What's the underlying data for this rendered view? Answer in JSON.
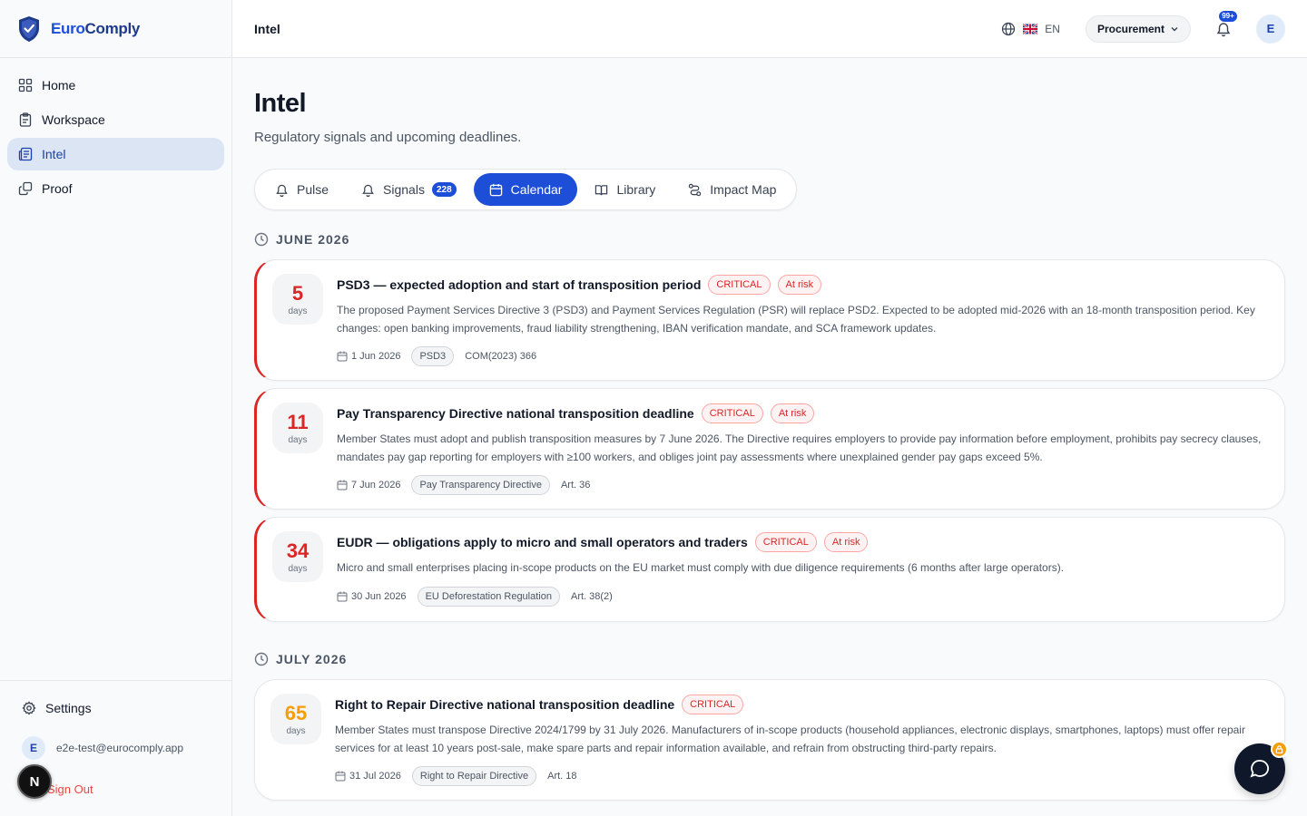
{
  "brand": {
    "name_part1": "Euro",
    "name_part2": "Comply"
  },
  "sidebar": {
    "items": [
      {
        "label": "Home",
        "icon": "grid-icon"
      },
      {
        "label": "Workspace",
        "icon": "clipboard-icon"
      },
      {
        "label": "Intel",
        "icon": "newspaper-icon",
        "active": true
      },
      {
        "label": "Proof",
        "icon": "copy-icon"
      }
    ],
    "settings_label": "Settings",
    "user_initial": "E",
    "user_email": "e2e-test@eurocomply.app",
    "signout_label": "Sign Out",
    "dev_badge": "N"
  },
  "header": {
    "title": "Intel",
    "language": "EN",
    "role": "Procurement",
    "notifications_badge": "99+",
    "avatar_initial": "E"
  },
  "page": {
    "title": "Intel",
    "subtitle": "Regulatory signals and upcoming deadlines."
  },
  "tabs": [
    {
      "label": "Pulse",
      "icon": "bell-icon"
    },
    {
      "label": "Signals",
      "icon": "bell-icon",
      "count": "228"
    },
    {
      "label": "Calendar",
      "icon": "calendar-icon",
      "active": true
    },
    {
      "label": "Library",
      "icon": "book-icon"
    },
    {
      "label": "Impact Map",
      "icon": "route-icon"
    }
  ],
  "months": [
    {
      "label": "JUNE 2026",
      "deadlines": [
        {
          "days": "5",
          "days_label": "days",
          "urgency_color": "#dc2626",
          "title": "PSD3 — expected adoption and start of transposition period",
          "severity": "CRITICAL",
          "status": "At risk",
          "description": "The proposed Payment Services Directive 3 (PSD3) and Payment Services Regulation (PSR) will replace PSD2. Expected to be adopted mid-2026 with an 18-month transposition period. Key changes: open banking improvements, fraud liability strengthening, IBAN verification mandate, and SCA framework updates.",
          "date": "1 Jun 2026",
          "tag": "PSD3",
          "reference": "COM(2023) 366"
        },
        {
          "days": "11",
          "days_label": "days",
          "urgency_color": "#dc2626",
          "title": "Pay Transparency Directive national transposition deadline",
          "severity": "CRITICAL",
          "status": "At risk",
          "description": "Member States must adopt and publish transposition measures by 7 June 2026. The Directive requires employers to provide pay information before employment, prohibits pay secrecy clauses, mandates pay gap reporting for employers with ≥100 workers, and obliges joint pay assessments where unexplained gender pay gaps exceed 5%.",
          "date": "7 Jun 2026",
          "tag": "Pay Transparency Directive",
          "reference": "Art. 36"
        },
        {
          "days": "34",
          "days_label": "days",
          "urgency_color": "#dc2626",
          "title": "EUDR — obligations apply to micro and small operators and traders",
          "severity": "CRITICAL",
          "status": "At risk",
          "description": "Micro and small enterprises placing in-scope products on the EU market must comply with due diligence requirements (6 months after large operators).",
          "date": "30 Jun 2026",
          "tag": "EU Deforestation Regulation",
          "reference": "Art. 38(2)"
        }
      ]
    },
    {
      "label": "JULY 2026",
      "deadlines": [
        {
          "days": "65",
          "days_label": "days",
          "urgency_color": "#f59e0b",
          "title": "Right to Repair Directive national transposition deadline",
          "severity": "CRITICAL",
          "description": "Member States must transpose Directive 2024/1799 by 31 July 2026. Manufacturers of in-scope products (household appliances, electronic displays, smartphones, laptops) must offer repair services for at least 10 years post-sale, make spare parts and repair information available, and refrain from obstructing third-party repairs.",
          "date": "31 Jul 2026",
          "tag": "Right to Repair Directive",
          "reference": "Art. 18"
        }
      ]
    }
  ],
  "colors": {
    "accent": "#1d4ed8",
    "critical": "#dc2626",
    "warning": "#f59e0b"
  }
}
